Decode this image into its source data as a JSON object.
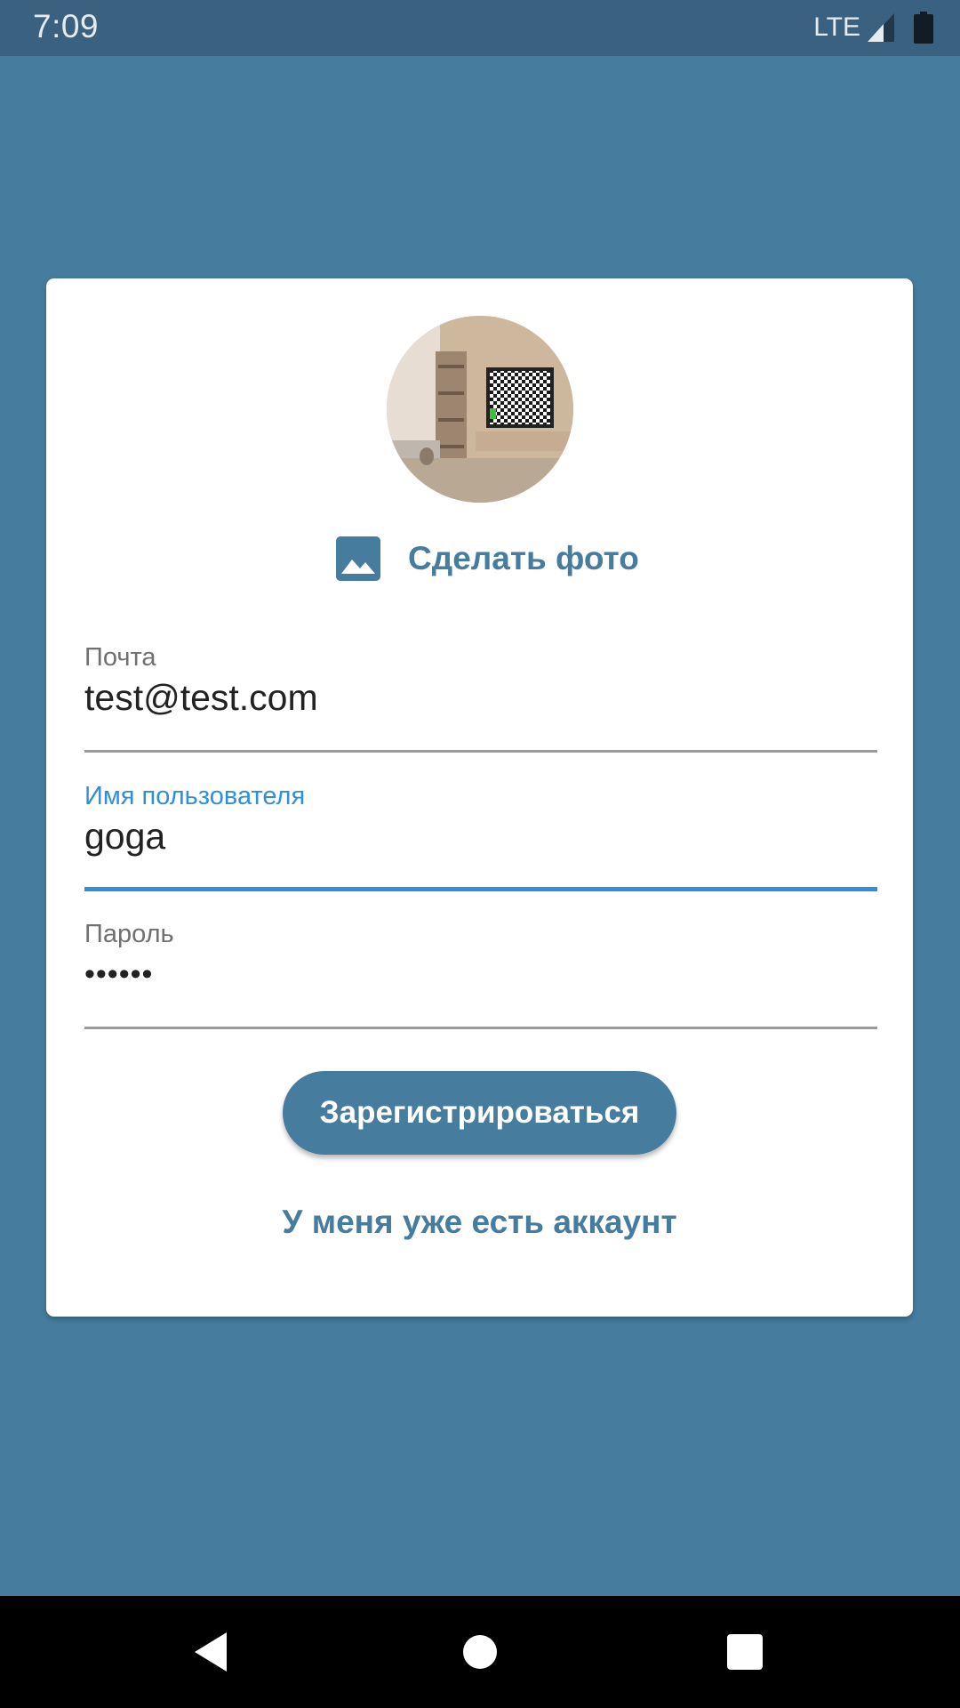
{
  "status_bar": {
    "time": "7:09",
    "network": "LTE",
    "icons": [
      "signal-icon",
      "battery-icon"
    ]
  },
  "avatar": {
    "icon": "profile-photo"
  },
  "photo_action": {
    "icon": "image-icon",
    "label": "Сделать фото"
  },
  "form": {
    "email": {
      "label": "Почта",
      "value": "test@test.com"
    },
    "username": {
      "label": "Имя пользователя",
      "value": "goga"
    },
    "password": {
      "label": "Пароль",
      "value": "••••••"
    }
  },
  "register_button": {
    "label": "Зарегистрироваться"
  },
  "login_link": {
    "label": "У меня уже есть аккаунт"
  },
  "nav_bar": {
    "icons": [
      "back-icon",
      "home-icon",
      "recents-icon"
    ]
  },
  "colors": {
    "background": "#467c9e",
    "status_bar": "#3a6180",
    "accent": "#467c9e",
    "focus": "#2f8fdb",
    "card": "#ffffff"
  }
}
